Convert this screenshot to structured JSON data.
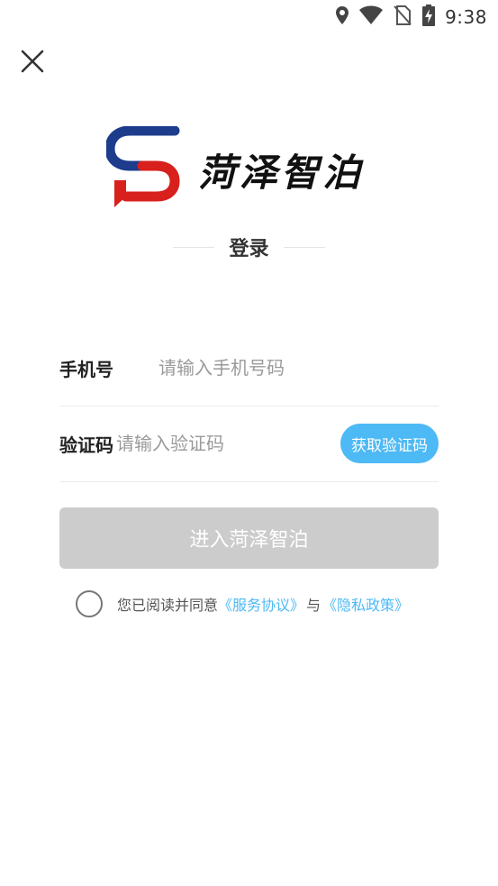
{
  "status_bar": {
    "time": "9:38",
    "icons": [
      "location-icon",
      "wifi-icon",
      "no-sim-icon",
      "battery-charging-icon"
    ]
  },
  "close": {
    "icon": "close-icon"
  },
  "logo": {
    "text": "菏泽智泊",
    "colors": {
      "blue": "#1e3c8c",
      "red": "#d8201c"
    }
  },
  "login": {
    "heading": "登录"
  },
  "form": {
    "phone": {
      "label": "手机号",
      "placeholder": "请输入手机号码",
      "value": ""
    },
    "code": {
      "label": "验证码",
      "placeholder": "请输入验证码",
      "value": "",
      "button": "获取验证码"
    }
  },
  "submit": {
    "label": "进入菏泽智泊"
  },
  "agreement": {
    "prefix": "您已阅读并同意",
    "service_link": "《服务协议》",
    "conjunction": "与",
    "privacy_link": "《隐私政策》",
    "checked": false
  },
  "colors": {
    "accent": "#4db9f5",
    "button_disabled": "#cccccc",
    "text_primary": "#222222",
    "placeholder": "#9a9a9a"
  }
}
